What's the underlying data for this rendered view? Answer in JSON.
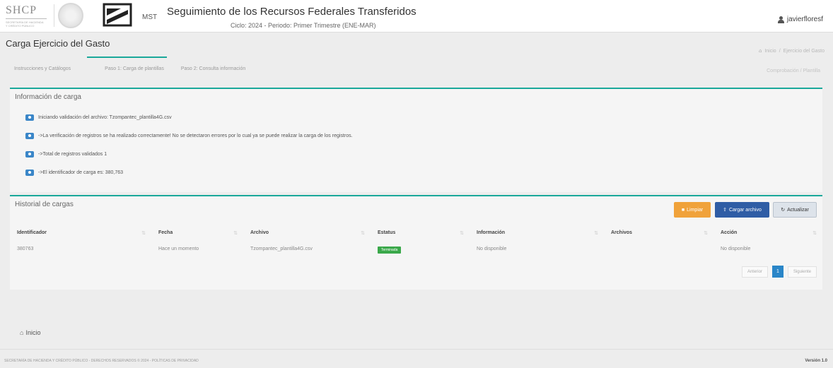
{
  "header": {
    "logo_text": "SHCP",
    "mst_text": "MST",
    "title": "Seguimiento de los Recursos Federales Transferidos",
    "subtitle": "Ciclo: 2024 - Periodo: Primer Trimestre (ENE-MAR)",
    "username": "javierfloresf"
  },
  "page": {
    "title": "Carga Ejercicio del Gasto",
    "breadcrumb_home": "Inicio",
    "breadcrumb_current": "Ejercicio del Gasto"
  },
  "steps": [
    "Instrucciones y Catálogos",
    "Paso 1: Carga de plantillas",
    "Paso 2: Consulta información"
  ],
  "step_tools": "Comprobación / Plantilla",
  "info_panel": {
    "title": "Información de carga",
    "lines": [
      "Iniciando validación del archivo: Tzompantec_plantilla4G.csv",
      "->La verificación de registros se ha realizado correctamente! No se detectaron errores por lo cual ya se puede realizar la carga de los registros.",
      "->Total de registros validados 1",
      "->El identificador de carga es: 380,763"
    ]
  },
  "history_panel": {
    "title": "Historial de cargas",
    "buttons": {
      "limpiar": "Limpiar",
      "cargar": "Cargar archivo",
      "actualizar": "Actualizar"
    },
    "columns": [
      "Identificador",
      "Fecha",
      "Archivo",
      "Estatus",
      "Información",
      "Archivos",
      "Acción"
    ],
    "rows": [
      {
        "identificador": "380763",
        "fecha": "Hace un momento",
        "archivo": "Tzompantec_plantilla4G.csv",
        "estatus": "Terminada",
        "informacion": "No disponible",
        "archivos": "",
        "accion": "No disponible"
      }
    ],
    "pager": {
      "prev": "Anterior",
      "page": "1",
      "next": "Siguiente"
    }
  },
  "footer": {
    "inicio": "Inicio",
    "legal": "SECRETARÍA DE HACIENDA Y CRÉDITO PÚBLICO - DERECHOS RESERVADOS © 2024 - POLÍTICAS DE PRIVACIDAD",
    "version": "Versión 1.0"
  },
  "colors": {
    "accent": "#1aa89a",
    "primary": "#2f5da5",
    "warning": "#f0a23a",
    "success": "#3aa84a",
    "info_icon": "#3a86c8"
  }
}
